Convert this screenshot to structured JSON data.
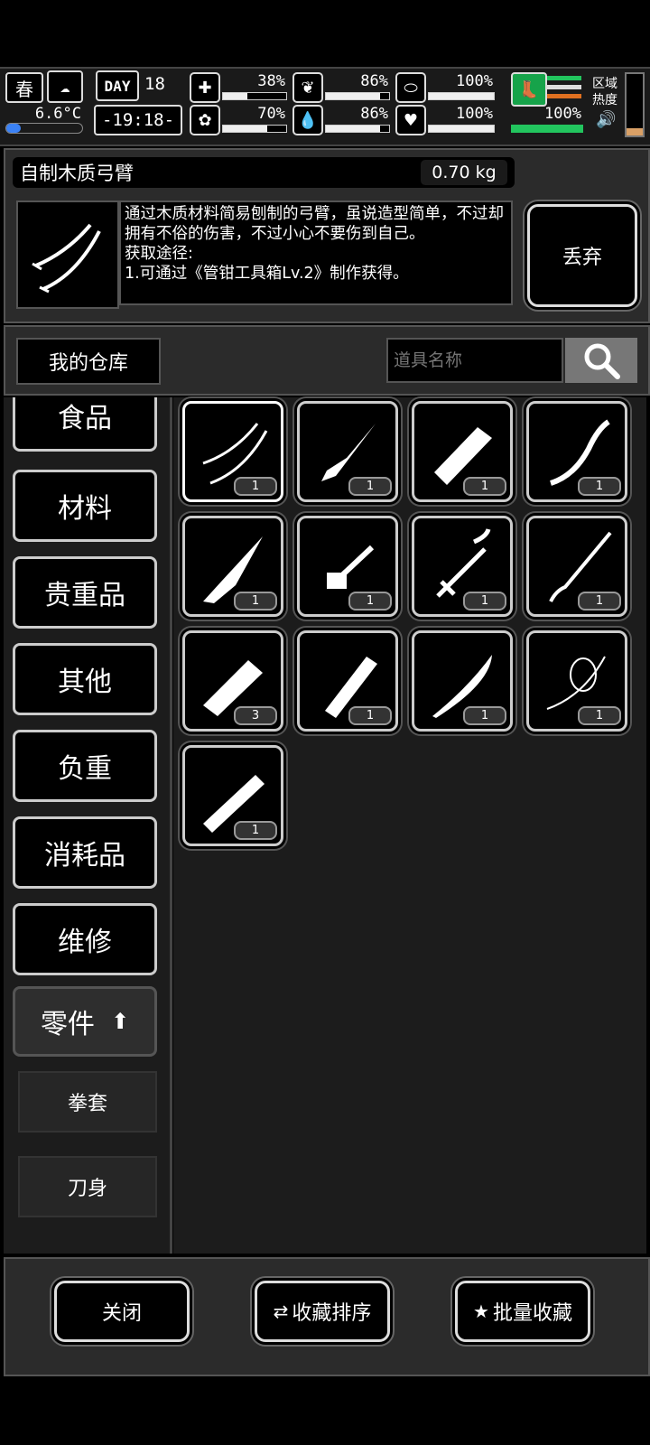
{
  "status": {
    "season": "春",
    "temperature": "6.6°C",
    "day_label": "DAY",
    "day": "18",
    "time": "-19:18-",
    "stats": [
      {
        "name": "health",
        "value": "38%",
        "level": 0.38
      },
      {
        "name": "hunger",
        "value": "86%",
        "level": 0.86
      },
      {
        "name": "stamina",
        "value": "100%",
        "level": 1.0
      },
      {
        "name": "mood",
        "value": "70%",
        "level": 0.7
      },
      {
        "name": "thirst",
        "value": "86%",
        "level": 0.86
      },
      {
        "name": "heart",
        "value": "100%",
        "level": 1.0
      }
    ],
    "carry_value": "100%",
    "carry_level": 1.0,
    "area_label_1": "区域",
    "area_label_2": "热度",
    "accent_green": "#22c55e",
    "accent_orange": "#e07020"
  },
  "item": {
    "title": "自制木质弓臂",
    "weight": "0.70 kg",
    "description": "通过木质材料简易刨制的弓臂，虽说造型简单，不过却拥有不俗的伤害，不过小心不要伤到自己。",
    "obtain_label": "获取途径:",
    "obtain_method": "1.可通过《管钳工具箱Lv.2》制作获得。",
    "discard_label": "丢弃"
  },
  "warehouse": {
    "tab_label": "我的仓库",
    "search_placeholder": "道具名称"
  },
  "categories": [
    {
      "label": "食品",
      "active": false
    },
    {
      "label": "材料",
      "active": false
    },
    {
      "label": "贵重品",
      "active": false
    },
    {
      "label": "其他",
      "active": false
    },
    {
      "label": "负重",
      "active": false
    },
    {
      "label": "消耗品",
      "active": false
    },
    {
      "label": "维修",
      "active": false
    },
    {
      "label": "零件",
      "active": true
    }
  ],
  "subcategories": [
    "拳套",
    "刀身"
  ],
  "items": [
    {
      "icon": "bow-limb-icon",
      "qty": "1",
      "selected": true
    },
    {
      "icon": "spear-head-icon",
      "qty": "1"
    },
    {
      "icon": "wooden-grip-icon",
      "qty": "1"
    },
    {
      "icon": "bow-arm-icon",
      "qty": "1"
    },
    {
      "icon": "blade-head-icon",
      "qty": "1"
    },
    {
      "icon": "trigger-part-icon",
      "qty": "1"
    },
    {
      "icon": "crossbow-stock-icon",
      "qty": "1"
    },
    {
      "icon": "needle-blade-icon",
      "qty": "1"
    },
    {
      "icon": "rough-grip-icon",
      "qty": "3"
    },
    {
      "icon": "wrapped-handle-icon",
      "qty": "1"
    },
    {
      "icon": "curved-blade-icon",
      "qty": "1"
    },
    {
      "icon": "bow-string-icon",
      "qty": "1"
    },
    {
      "icon": "barrel-part-icon",
      "qty": "1"
    }
  ],
  "bottom": {
    "close_label": "关闭",
    "sort_label": "收藏排序",
    "batch_label": "批量收藏"
  }
}
